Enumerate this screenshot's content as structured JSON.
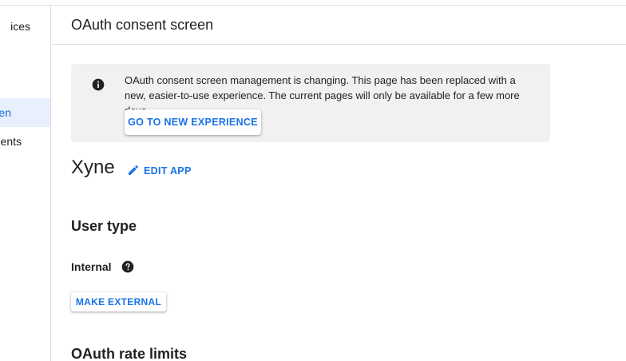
{
  "sidebar": {
    "items": [
      {
        "label": "ices"
      },
      {
        "label": "en"
      },
      {
        "label": "ents"
      }
    ]
  },
  "header": {
    "title": "OAuth consent screen"
  },
  "banner": {
    "icon": "info-icon",
    "text": "OAuth consent screen management is changing. This page has been replaced with a new, easier-to-use experience. The current pages will only be available for a few more days.",
    "button_label": "GO TO NEW EXPERIENCE"
  },
  "app": {
    "name": "Xyne",
    "edit_label": "EDIT APP",
    "edit_icon": "pencil-icon"
  },
  "user_type": {
    "title": "User type",
    "value": "Internal",
    "help_icon": "help-icon",
    "make_external_label": "MAKE EXTERNAL"
  },
  "rate_limits": {
    "title": "OAuth rate limits"
  },
  "colors": {
    "accent": "#1a73e8",
    "active_nav_bg": "#e8f0fe",
    "banner_bg": "#f1f1f1"
  }
}
